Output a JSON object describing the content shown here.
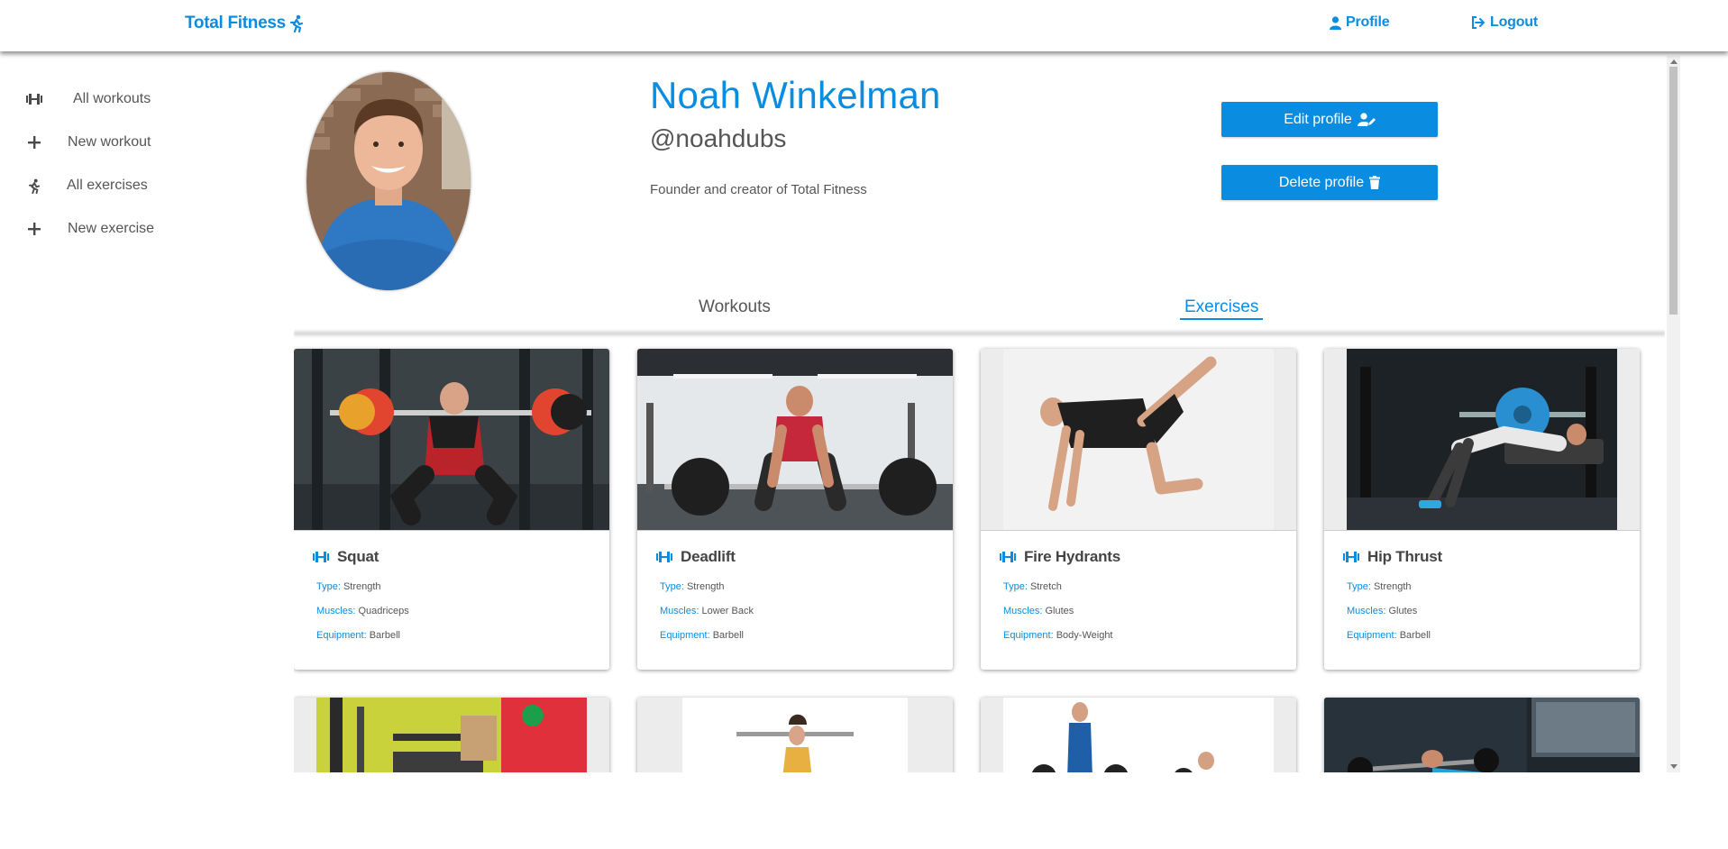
{
  "brand": {
    "name": "Total Fitness",
    "icon": "running-person-icon"
  },
  "nav": {
    "profile_label": "Profile",
    "logout_label": "Logout"
  },
  "sidebar": {
    "items": [
      {
        "label": "All workouts",
        "icon": "dumbbell-icon"
      },
      {
        "label": "New workout",
        "icon": "plus-icon"
      },
      {
        "label": "All exercises",
        "icon": "running-person-icon"
      },
      {
        "label": "New exercise",
        "icon": "plus-icon"
      }
    ]
  },
  "profile": {
    "name": "Noah Winkelman",
    "handle": "@noahdubs",
    "bio": "Founder and creator of Total Fitness",
    "edit_label": "Edit profile",
    "delete_label": "Delete profile"
  },
  "tabs": [
    {
      "label": "Workouts",
      "active": false
    },
    {
      "label": "Exercises",
      "active": true
    }
  ],
  "labels": {
    "type": "Type:",
    "muscles": "Muscles:",
    "equipment": "Equipment:"
  },
  "exercises": [
    {
      "name": "Squat",
      "type": "Strength",
      "muscles": "Quadriceps",
      "equipment": "Barbell"
    },
    {
      "name": "Deadlift",
      "type": "Strength",
      "muscles": "Lower Back",
      "equipment": "Barbell"
    },
    {
      "name": "Fire Hydrants",
      "type": "Stretch",
      "muscles": "Glutes",
      "equipment": "Body-Weight"
    },
    {
      "name": "Hip Thrust",
      "type": "Strength",
      "muscles": "Glutes",
      "equipment": "Barbell"
    }
  ],
  "colors": {
    "accent": "#0a8de0",
    "text": "#4a4a4a"
  }
}
